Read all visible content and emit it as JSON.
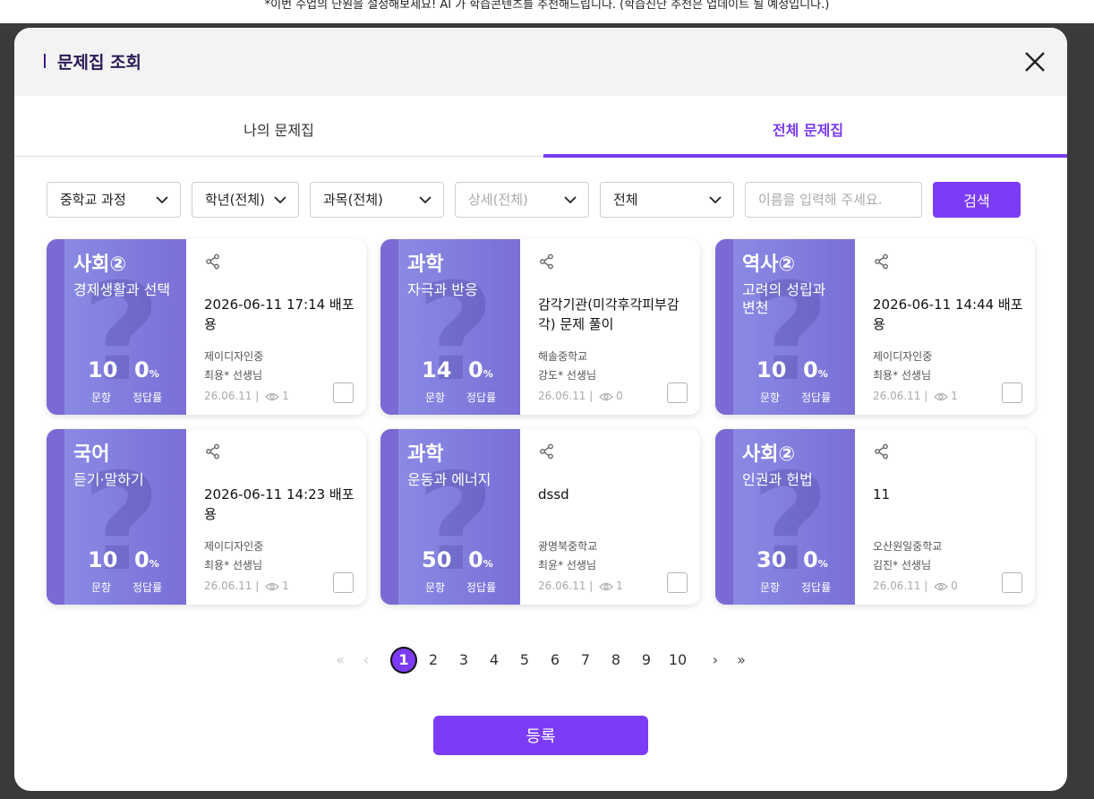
{
  "background": {
    "notice": "*이번 수업의 단원을 설정해보세요! AI 가 학습콘텐츠를 추천해드립니다. (학습진단 추천은 업데이트 될 예정입니다.)"
  },
  "modal": {
    "title": "문제집 조회",
    "close_icon": "close-icon"
  },
  "tabs": [
    {
      "label": "나의 문제집",
      "active": false
    },
    {
      "label": "전체 문제집",
      "active": true
    }
  ],
  "filters": {
    "course": "중학교 과정",
    "grade": "학년(전체)",
    "subject": "과목(전체)",
    "detail": "상세(전체)",
    "scope": "전체",
    "search_placeholder": "이름을 입력해 주세요.",
    "search_label": "검색"
  },
  "labels": {
    "count": "문항",
    "rate": "정답률",
    "rate_unit": "%"
  },
  "colors": {
    "accent": "#7c3cf5",
    "cover_start": "#8c8ee6",
    "cover_end": "#7a6fd6"
  },
  "cards": [
    {
      "subject": "사회②",
      "unit": "경제생활과 선택",
      "count": "10",
      "rate": "0",
      "title": "2026-06-11 17:14 배포용",
      "school": "제이디자인중",
      "teacher": "최용* 선생님",
      "date": "26.06.11",
      "views": "1"
    },
    {
      "subject": "과학",
      "unit": "자극과 반응",
      "count": "14",
      "rate": "0",
      "title": "감각기관(미각후각피부감각) 문제 풀이",
      "school": "해솔중학교",
      "teacher": "강도* 선생님",
      "date": "26.06.11",
      "views": "0"
    },
    {
      "subject": "역사②",
      "unit": "고려의 성립과 변천",
      "count": "10",
      "rate": "0",
      "title": "2026-06-11 14:44 배포용",
      "school": "제이디자인중",
      "teacher": "최용* 선생님",
      "date": "26.06.11",
      "views": "1"
    },
    {
      "subject": "국어",
      "unit": "듣기·말하기",
      "count": "10",
      "rate": "0",
      "title": "2026-06-11 14:23 배포용",
      "school": "제이디자인중",
      "teacher": "최용* 선생님",
      "date": "26.06.11",
      "views": "1"
    },
    {
      "subject": "과학",
      "unit": "운동과 에너지",
      "count": "50",
      "rate": "0",
      "title": "dssd",
      "school": "광명북중학교",
      "teacher": "최윤* 선생님",
      "date": "26.06.11",
      "views": "1"
    },
    {
      "subject": "사회②",
      "unit": "인권과 헌법",
      "count": "30",
      "rate": "0",
      "title": "11",
      "school": "오산원일중학교",
      "teacher": "김진* 선생님",
      "date": "26.06.11",
      "views": "0"
    }
  ],
  "pagination": {
    "first": "«",
    "prev": "‹",
    "pages": [
      "1",
      "2",
      "3",
      "4",
      "5",
      "6",
      "7",
      "8",
      "9",
      "10"
    ],
    "current": "1",
    "next": "›",
    "last": "»"
  },
  "register_label": "등록"
}
